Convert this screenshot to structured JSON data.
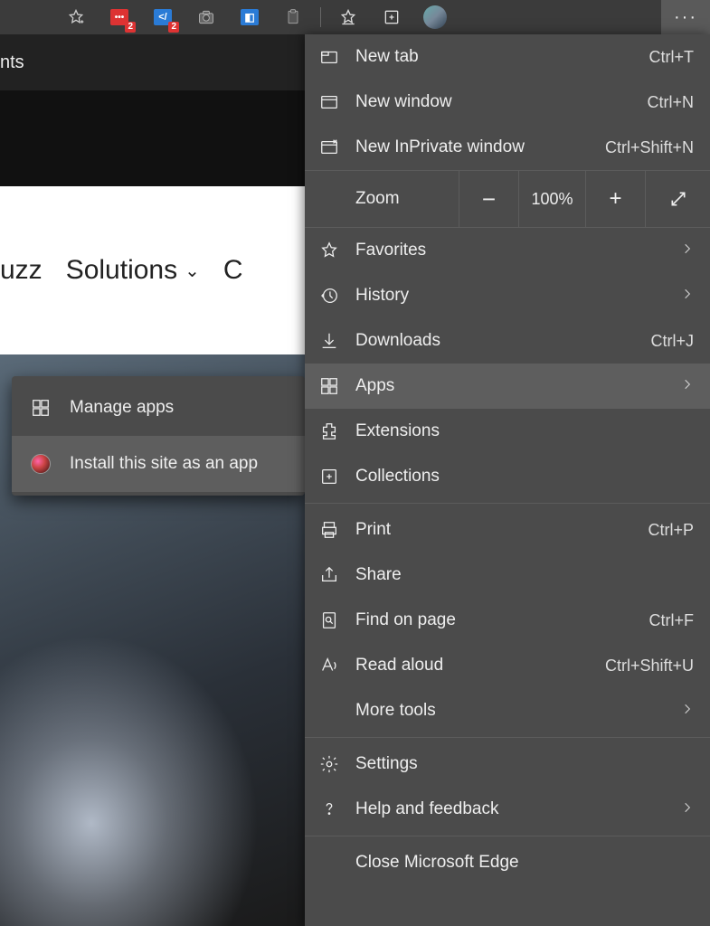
{
  "toolbar": {
    "badge1": "2",
    "badge2": "2",
    "more": "···"
  },
  "page": {
    "strip_text": "nts",
    "nav_uzz": "uzz",
    "nav_solutions": "Solutions",
    "nav_c": "C"
  },
  "submenu": {
    "manage": "Manage apps",
    "install": "Install this site as an app"
  },
  "menu": {
    "new_tab": {
      "label": "New tab",
      "shortcut": "Ctrl+T"
    },
    "new_window": {
      "label": "New window",
      "shortcut": "Ctrl+N"
    },
    "new_inprivate": {
      "label": "New InPrivate window",
      "shortcut": "Ctrl+Shift+N"
    },
    "zoom": {
      "label": "Zoom",
      "value": "100%"
    },
    "favorites": {
      "label": "Favorites"
    },
    "history": {
      "label": "History"
    },
    "downloads": {
      "label": "Downloads",
      "shortcut": "Ctrl+J"
    },
    "apps": {
      "label": "Apps"
    },
    "extensions": {
      "label": "Extensions"
    },
    "collections": {
      "label": "Collections"
    },
    "print": {
      "label": "Print",
      "shortcut": "Ctrl+P"
    },
    "share": {
      "label": "Share"
    },
    "find": {
      "label": "Find on page",
      "shortcut": "Ctrl+F"
    },
    "read_aloud": {
      "label": "Read aloud",
      "shortcut": "Ctrl+Shift+U"
    },
    "more_tools": {
      "label": "More tools"
    },
    "settings": {
      "label": "Settings"
    },
    "help": {
      "label": "Help and feedback"
    },
    "close": {
      "label": "Close Microsoft Edge"
    }
  }
}
